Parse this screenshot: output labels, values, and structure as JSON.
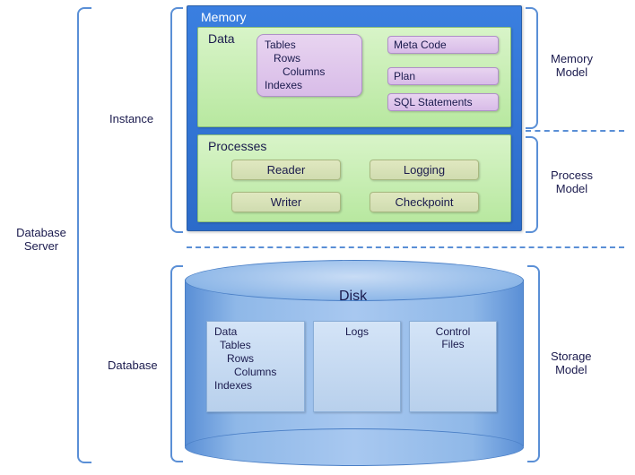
{
  "title": "Database Server",
  "instance": {
    "label": "Instance",
    "memory": "Memory",
    "data": {
      "label": "Data",
      "lines": [
        "Tables",
        "Rows",
        "Columns",
        "Indexes"
      ]
    },
    "meta": "Meta Code",
    "plan": "Plan",
    "sql": "SQL Statements",
    "processes": {
      "label": "Processes",
      "reader": "Reader",
      "writer": "Writer",
      "logging": "Logging",
      "checkpoint": "Checkpoint"
    }
  },
  "database": {
    "label": "Database",
    "disk": "Disk",
    "data": {
      "lines": [
        "Data",
        "Tables",
        "Rows",
        "Columns",
        "Indexes"
      ]
    },
    "logs": "Logs",
    "control": "Control\nFiles"
  },
  "rhs": {
    "memory": "Memory\nModel",
    "process": "Process\nModel",
    "storage": "Storage\nModel"
  }
}
